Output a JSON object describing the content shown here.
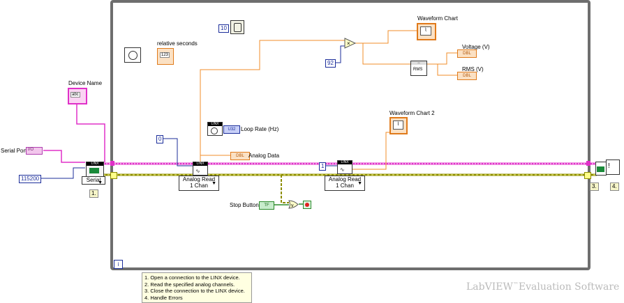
{
  "labels": {
    "serial_port": "Serial Port",
    "device_name": "Device Name",
    "relative_seconds": "relative seconds",
    "waveform_chart": "Waveform Chart",
    "voltage": "Voltage (V)",
    "rms": "RMS (V)",
    "loop_rate": "Loop Rate (Hz)",
    "analog_data": "Analog Data",
    "waveform_chart_2": "Waveform Chart 2",
    "stop_button": "Stop Button"
  },
  "constants": {
    "baud": "115200",
    "channel_a": "0",
    "channel_b": "1",
    "wait_ms": "10",
    "multiplier": "92"
  },
  "indicators": {
    "dbl": "DBL",
    "u32": "U32",
    "tf": "TF",
    "abc": "abc",
    "timestamp": "123",
    "rms_block": "RMS",
    "linx": "LINX"
  },
  "selectors": {
    "serial": "Serial",
    "analog_read_1_line1": "Analog Read",
    "analog_read_1_line2": "1 Chan",
    "analog_read_2_line1": "Analog Read",
    "analog_read_2_line2": "1 Chan"
  },
  "steps": {
    "s1": "1.",
    "s3": "3.",
    "s4": "4.",
    "info": "i"
  },
  "notes": [
    "1. Open a connection to the LINX device.",
    "2. Read the specified analog channels.",
    "3. Close the connection to the LINX device.",
    "4. Handle Errors"
  ],
  "watermark": {
    "product": "LabVIEW",
    "tm": "™",
    "edition": "Evaluation Software"
  },
  "colors": {
    "loop_border": "#6e6e6e",
    "visa_wire": "#e030c8",
    "error_wire": "#8c8c00",
    "dbl_wire": "#f08c28",
    "int_wire": "#1b2d9a",
    "bool_wire": "#2a8a2a"
  }
}
